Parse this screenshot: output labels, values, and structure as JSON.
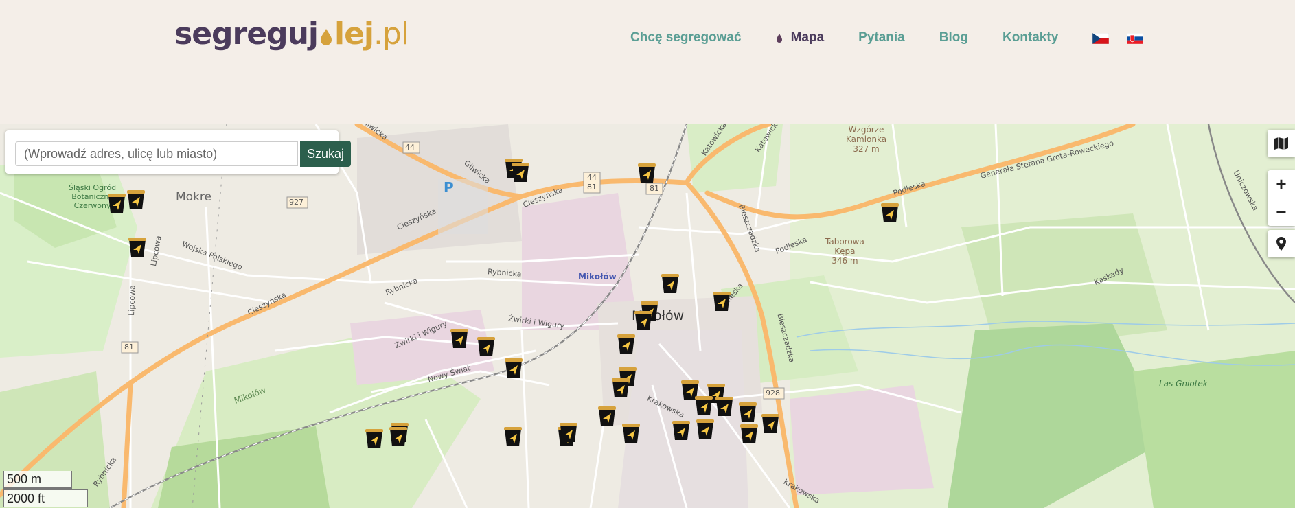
{
  "header": {
    "logo_prefix": "segreguj",
    "logo_mid": "lej",
    "logo_suffix": ".pl",
    "logo_alt": "segregujolej.pl"
  },
  "nav": {
    "items": [
      {
        "label": "Chcę segregować"
      },
      {
        "label": "Mapa"
      },
      {
        "label": "Pytania"
      },
      {
        "label": "Blog"
      },
      {
        "label": "Kontakty"
      }
    ],
    "active_index": 1,
    "languages": [
      {
        "code": "cs",
        "flag": "czech-flag"
      },
      {
        "code": "sk",
        "flag": "slovak-flag"
      }
    ]
  },
  "search": {
    "placeholder": "(Wprowadź adres, ulicę lub miasto)",
    "button_label": "Szukaj"
  },
  "map_controls": {
    "layers_icon": "map-icon",
    "zoom_in": "+",
    "zoom_out": "−",
    "locate_icon": "location-pin-icon"
  },
  "scale": {
    "metric": "500 m",
    "imperial": "2000 ft"
  },
  "map_labels": {
    "mokre": "Mokre",
    "garden": "Śląski Ogród Botaniczny Czerwony",
    "garden_1": "Śląski Ogród",
    "garden_2": "Botaniczny",
    "garden_3": "Czerwony",
    "wzgorze_1": "Wzgórze",
    "wzgorze_2": "Kamionka",
    "wzgorze_3": "327 m",
    "taborowa_1": "Taborowa",
    "taborowa_2": "Kępa",
    "taborowa_3": "346 m",
    "mikolow_station": "Mikołów",
    "mikolow_town": "Mikołów",
    "mikolow_forest": "Mikołów",
    "las": "Las Gniotek",
    "gliwicka": "Gliwicka",
    "cieszynska1": "Cieszyńska",
    "cieszynska2": "Cieszyńska",
    "cieszynska3": "Cieszyńska",
    "rybnicka1": "Rybnicka",
    "rybnicka2": "Rybnicka",
    "rybnicka3": "Rybnicka",
    "wojska": "Wojska Polskiego",
    "lipcowa1": "Lipcowa",
    "lipcowa2": "Lipcowa",
    "zwirki": "Żwirki i Wigury",
    "zwirki2": "Żwirki i Wigury",
    "nowy_swiat": "Nowy Świat",
    "katowicka": "Katowicka",
    "bieszczadzka": "Bieszczadzka",
    "podleska": "Podleska",
    "podleska2": "Podleska",
    "grota": "Generała Stefana Grota-Roweckiego",
    "kaskady": "Kaskady",
    "unicka": "Uniczowska",
    "krakowska": "Krakowska",
    "road44a": "44",
    "road44b": "44",
    "road81a": "81",
    "road81b": "81",
    "road81c": "81",
    "road927": "927",
    "road928": "928",
    "parking": "P"
  },
  "markers_count": 34
}
